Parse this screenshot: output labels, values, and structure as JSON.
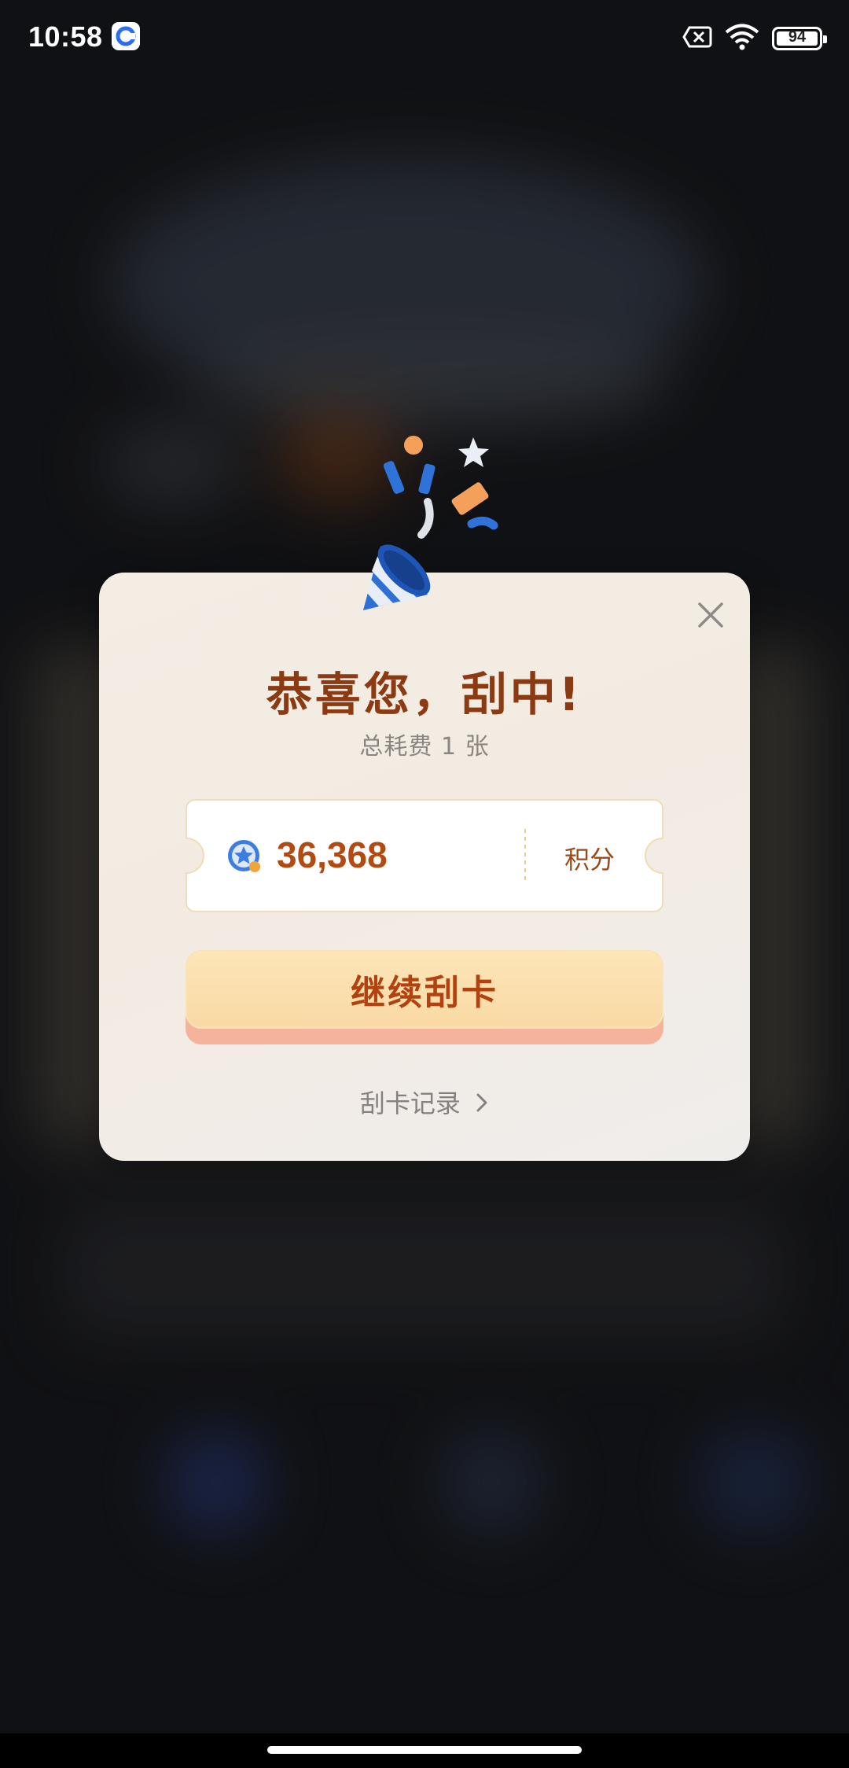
{
  "status_bar": {
    "time": "10:58",
    "battery_level": "94",
    "icons": [
      "app-notification-icon",
      "sim-off-icon",
      "wifi-icon",
      "battery-icon"
    ]
  },
  "dialog": {
    "title": "恭喜您，刮中!",
    "subtitle": "总耗费 1 张",
    "reward": {
      "value": "36,368",
      "unit": "积分",
      "icon": "points-coin-icon"
    },
    "continue_button_label": "继续刮卡",
    "record_link_label": "刮卡记录",
    "close_icon": "close-icon"
  },
  "colors": {
    "title": "#8c3a12",
    "points": "#b24a12",
    "button_face": "#f9d9a4",
    "button_shadow": "#f4b39a",
    "button_text": "#b2420f"
  }
}
